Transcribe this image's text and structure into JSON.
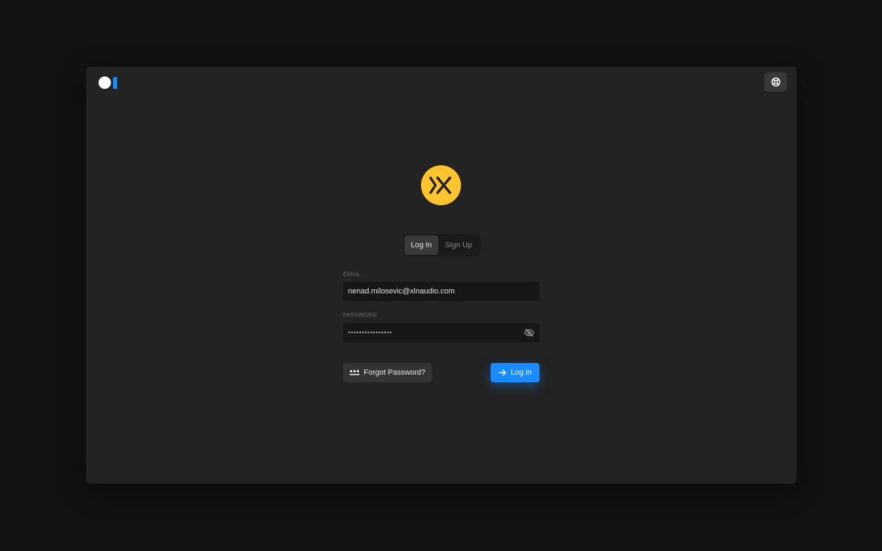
{
  "colors": {
    "accent": "#1a8cff",
    "logo_yellow": "#ffc42e",
    "window_bg": "#232323",
    "page_bg": "#121212"
  },
  "header": {
    "brand_icon": "brand-mark-icon",
    "help_icon": "lifebuoy-icon"
  },
  "logo": {
    "icon": "xln-logo-icon"
  },
  "tabs": {
    "login_label": "Log In",
    "signup_label": "Sign Up",
    "selected": "Log In"
  },
  "form": {
    "email_label": "EMAIL",
    "email_value": "nenad.milosevic@xlnaudio.com",
    "password_label": "PASSWORD",
    "password_value": "••••••••••••••••",
    "eye_icon": "eye-off-icon"
  },
  "actions": {
    "forgot_label": "Forgot Password?",
    "forgot_icon": "dots-icon",
    "login_label": "Log In",
    "login_icon": "arrow-right-icon"
  }
}
